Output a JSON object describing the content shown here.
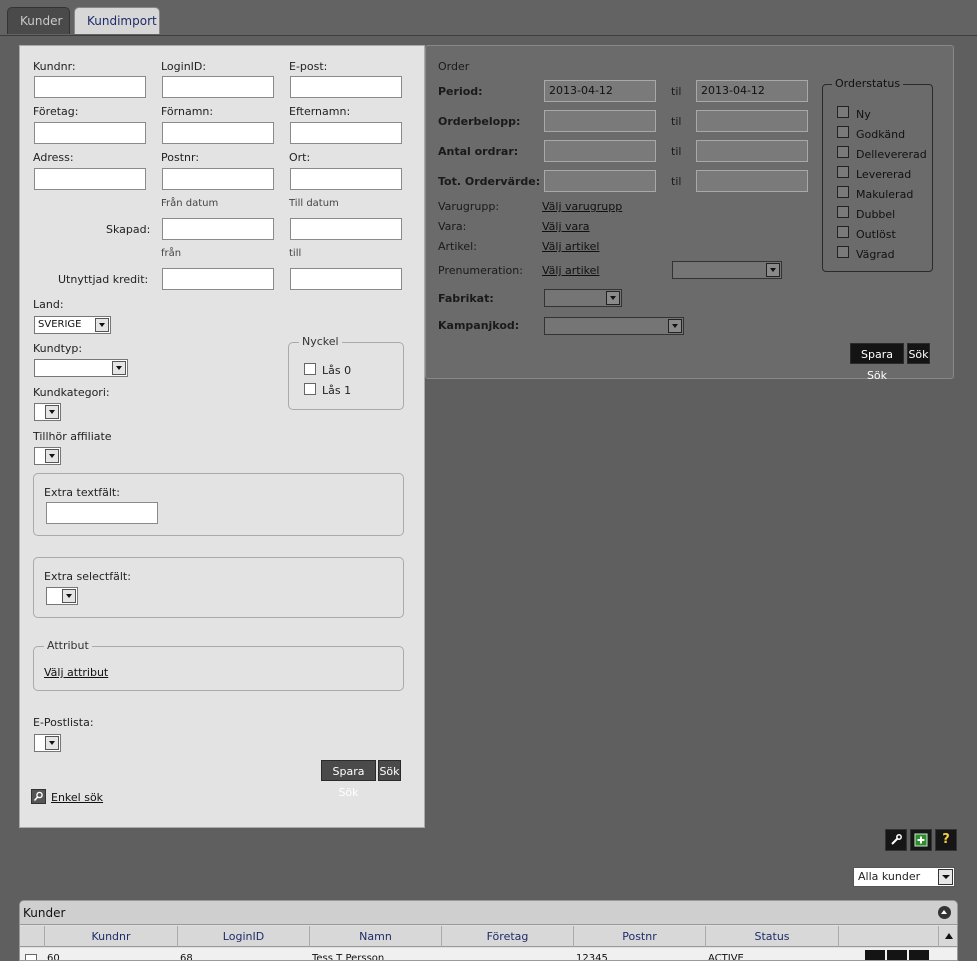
{
  "tabs": [
    {
      "label": "Kunder"
    },
    {
      "label": "Kundimport"
    }
  ],
  "left": {
    "kundnr": "Kundnr:",
    "loginid": "LoginID:",
    "epost": "E-post:",
    "foretag": "Företag:",
    "fornamn": "Förnamn:",
    "efternamn": "Efternamn:",
    "adress": "Adress:",
    "postnr": "Postnr:",
    "ort": "Ort:",
    "fran_datum": "Från datum",
    "till_datum": "Till datum",
    "skapad": "Skapad:",
    "fran": "från",
    "till": "till",
    "kredit": "Utnyttjad kredit:",
    "land": "Land:",
    "land_value": "SVERIGE",
    "kundtyp": "Kundtyp:",
    "kundkategori": "Kundkategori:",
    "affiliate": "Tillhör affiliate",
    "nyckel": "Nyckel",
    "las0": "Lås 0",
    "las1": "Lås 1",
    "extra_text": "Extra textfält:",
    "extra_select": "Extra selectfält:",
    "attribut": "Attribut",
    "valj_attribut": "Välj attribut",
    "epostlista": "E-Postlista:",
    "spara_sok": "Spara Sök",
    "sok": "Sök",
    "enkel_sok": "Enkel sök"
  },
  "order": {
    "title": "Order",
    "period": "Period:",
    "period_from": "2013-04-12",
    "period_to": "2013-04-12",
    "til": "til",
    "orderbelopp": "Orderbelopp:",
    "antal": "Antal ordrar:",
    "tot": "Tot. Ordervärde:",
    "varugrupp": "Varugrupp:",
    "valj_varugrupp": "Välj varugrupp",
    "vara": "Vara:",
    "valj_vara": "Välj vara",
    "artikel": "Artikel:",
    "valj_artikel": "Välj artikel",
    "prenumeration": "Prenumeration:",
    "valj_artikel2": "Välj artikel",
    "fabrikat": "Fabrikat:",
    "kampanjkod": "Kampanjkod:",
    "spara_sok": "Spara Sök",
    "sok": "Sök",
    "orderstatus": "Orderstatus",
    "statuses": [
      "Ny",
      "Godkänd",
      "Dellevererad",
      "Levererad",
      "Makulerad",
      "Dubbel",
      "Outlöst",
      "Vägrad"
    ]
  },
  "toolbar": {
    "tool_icon": "wrench-icon",
    "add_icon": "plus-icon",
    "help_label": "?"
  },
  "filter": {
    "value": "Alla kunder"
  },
  "grid": {
    "title": "Kunder",
    "columns": [
      "Kundnr",
      "LoginID",
      "Namn",
      "Företag",
      "Postnr",
      "Status"
    ],
    "row": {
      "kundnr": "60",
      "loginid": "68",
      "namn": "Tess T Persson",
      "foretag": "",
      "postnr": "12345",
      "status": "ACTIVE"
    }
  }
}
